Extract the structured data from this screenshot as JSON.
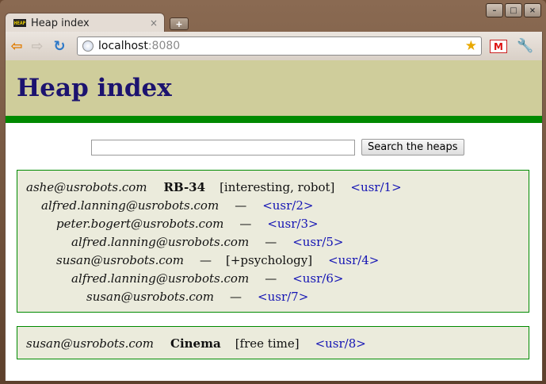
{
  "browser": {
    "tab_title": "Heap index",
    "tab_favicon": "HEAP",
    "tab_close": "×",
    "new_tab": "+",
    "url_host": "localhost",
    "url_port": ":8080",
    "window_minimize": "–",
    "window_maximize": "□",
    "window_close": "×",
    "back": "⇦",
    "forward": "⇨",
    "reload": "↻",
    "bookmark_star": "★",
    "gmail_label": "M",
    "wrench": "🔧"
  },
  "page": {
    "heading": "Heap index",
    "search_placeholder": "",
    "search_button": "Search the heaps",
    "accent_color": "#008a00",
    "header_color": "#cfcd9b",
    "heading_color": "#1c136f",
    "link_color": "#1414b4"
  },
  "heaps": [
    {
      "rows": [
        {
          "author": "ashe@usrobots.com",
          "title": "RB-34",
          "tags": "[interesting, robot]",
          "dash": "",
          "link": "<usr/1>"
        },
        {
          "author": "alfred.lanning@usrobots.com",
          "title": "",
          "tags": "",
          "dash": "—",
          "link": "<usr/2>"
        },
        {
          "author": "peter.bogert@usrobots.com",
          "title": "",
          "tags": "",
          "dash": "—",
          "link": "<usr/3>"
        },
        {
          "author": "alfred.lanning@usrobots.com",
          "title": "",
          "tags": "",
          "dash": "—",
          "link": "<usr/5>"
        },
        {
          "author": "susan@usrobots.com",
          "title": "",
          "tags": "[+psychology]",
          "dash": "—",
          "link": "<usr/4>"
        },
        {
          "author": "alfred.lanning@usrobots.com",
          "title": "",
          "tags": "",
          "dash": "—",
          "link": "<usr/6>"
        },
        {
          "author": "susan@usrobots.com",
          "title": "",
          "tags": "",
          "dash": "—",
          "link": "<usr/7>"
        }
      ]
    },
    {
      "rows": [
        {
          "author": "susan@usrobots.com",
          "title": "Cinema",
          "tags": "[free time]",
          "dash": "",
          "link": "<usr/8>"
        }
      ]
    }
  ]
}
